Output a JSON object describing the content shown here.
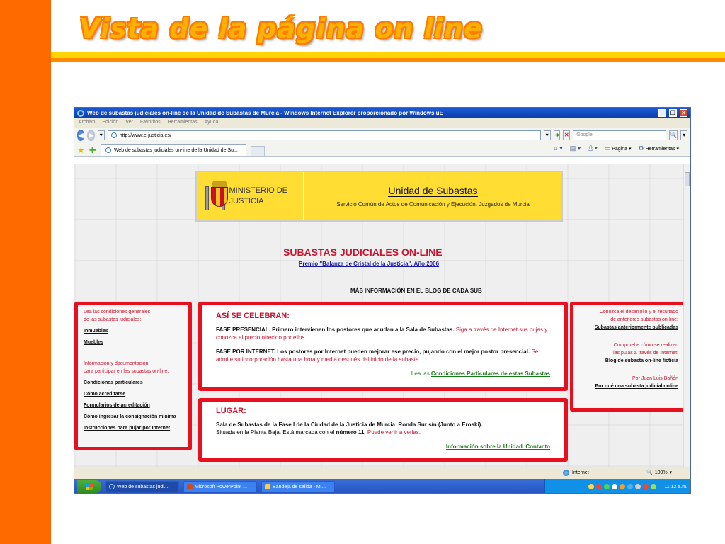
{
  "slide": {
    "title": "Vista de la página on line",
    "colors": {
      "orange": "#ff6a00",
      "yellow": "#ffd400",
      "title_fill": "#ffb000"
    }
  },
  "browser": {
    "window_title": "Web de subastas judiciales on-line de la Unidad de Subastas de Murcia - Windows Internet Explorer proporcionado por Windows uE",
    "menu": [
      "Archivo",
      "Edición",
      "Ver",
      "Favoritos",
      "Herramientas",
      "Ayuda"
    ],
    "url": "http://www.e-justicia.es/",
    "search_placeholder": "Google",
    "tab_title": "Web de subastas judiciales on-line de la Unidad de Su...",
    "tools": {
      "page": "Página",
      "tools": "Herramientas"
    }
  },
  "page": {
    "ministerio": "MINISTERIO DE JUSTICIA",
    "unidad_title": "Unidad de Subastas",
    "unidad_subtitle": "Servicio Común de Actos de Comunicación y Ejecución. Juzgados de Murcia",
    "main_title": "SUBASTAS JUDICIALES ON-LINE",
    "premio_link": "Premio \"Balanza de Cristal de la Justicia\". Año 2006",
    "mas_info": "MÁS INFORMACIÓN EN EL BLOG DE CADA SUB",
    "left": {
      "heading1_line1": "Lea las condiciones generales",
      "heading1_line2": "de las subastas judiciales:",
      "link_inmuebles": "Inmuebles",
      "link_muebles": "Muebles",
      "heading2_line1": "Información y documentación",
      "heading2_line2": "para participar en las subastas on-line:",
      "link_condiciones": "Condiciones particulares",
      "link_acreditarse": "Cómo acreditarse",
      "link_formularios": "Formularios de acreditación",
      "link_consignacion": "Cómo ingresar la consignación mínima",
      "link_instrucciones": "Instrucciones para pujar por Internet"
    },
    "celebran": {
      "heading": "ASÍ SE CELEBRAN:",
      "presencial_bold": "FASE PRESENCIAL. Primero intervienen los postores que acudan a la Sala de Subastas.",
      "presencial_red": "Siga a través de Internet sus pujas y conozca el precio ofrecido por ellos.",
      "internet_bold": "FASE POR INTERNET. Los postores por Internet pueden mejorar ese precio, pujando con el mejor postor presencial.",
      "internet_red": "Se admite su incorporación hasta una hora y media después del inicio de la subasta.",
      "lea_las": "Lea las",
      "condiciones_link": "Condiciones Particulares de estas Subastas"
    },
    "lugar": {
      "heading": "LUGAR:",
      "line1_bold": "Sala de Subastas de la Fase I de la Ciudad de la Justicia de Murcia. Ronda Sur s/n (Junto a Eroski).",
      "line2_a": "Situada en la Planta Baja. Está marcada con el",
      "line2_num": "número 11",
      "line2_red": "Puede venir a verlas.",
      "info_link": "Información sobre la Unidad. Contacto"
    },
    "right": {
      "text1_line1": "Conozca el desarrollo y el resultado",
      "text1_line2": "de anteriores subastas on-line:",
      "link1": "Subastas anteriormente publicadas",
      "text2_line1": "Compruebe cómo se realizan",
      "text2_line2": "las pujas a través de Internet:",
      "link2": "Blog de subasta on-line ficticia",
      "text3": "Por Juan Luis Bañón",
      "link3": "Por qué una subasta judicial online"
    }
  },
  "status": {
    "zone": "Internet",
    "zoom": "100%"
  },
  "taskbar": {
    "tasks": [
      "Web de subastas judi...",
      "Microsoft PowerPoint ...",
      "Bandeja de salida - Mi..."
    ],
    "clock": "11:12 a.m."
  }
}
